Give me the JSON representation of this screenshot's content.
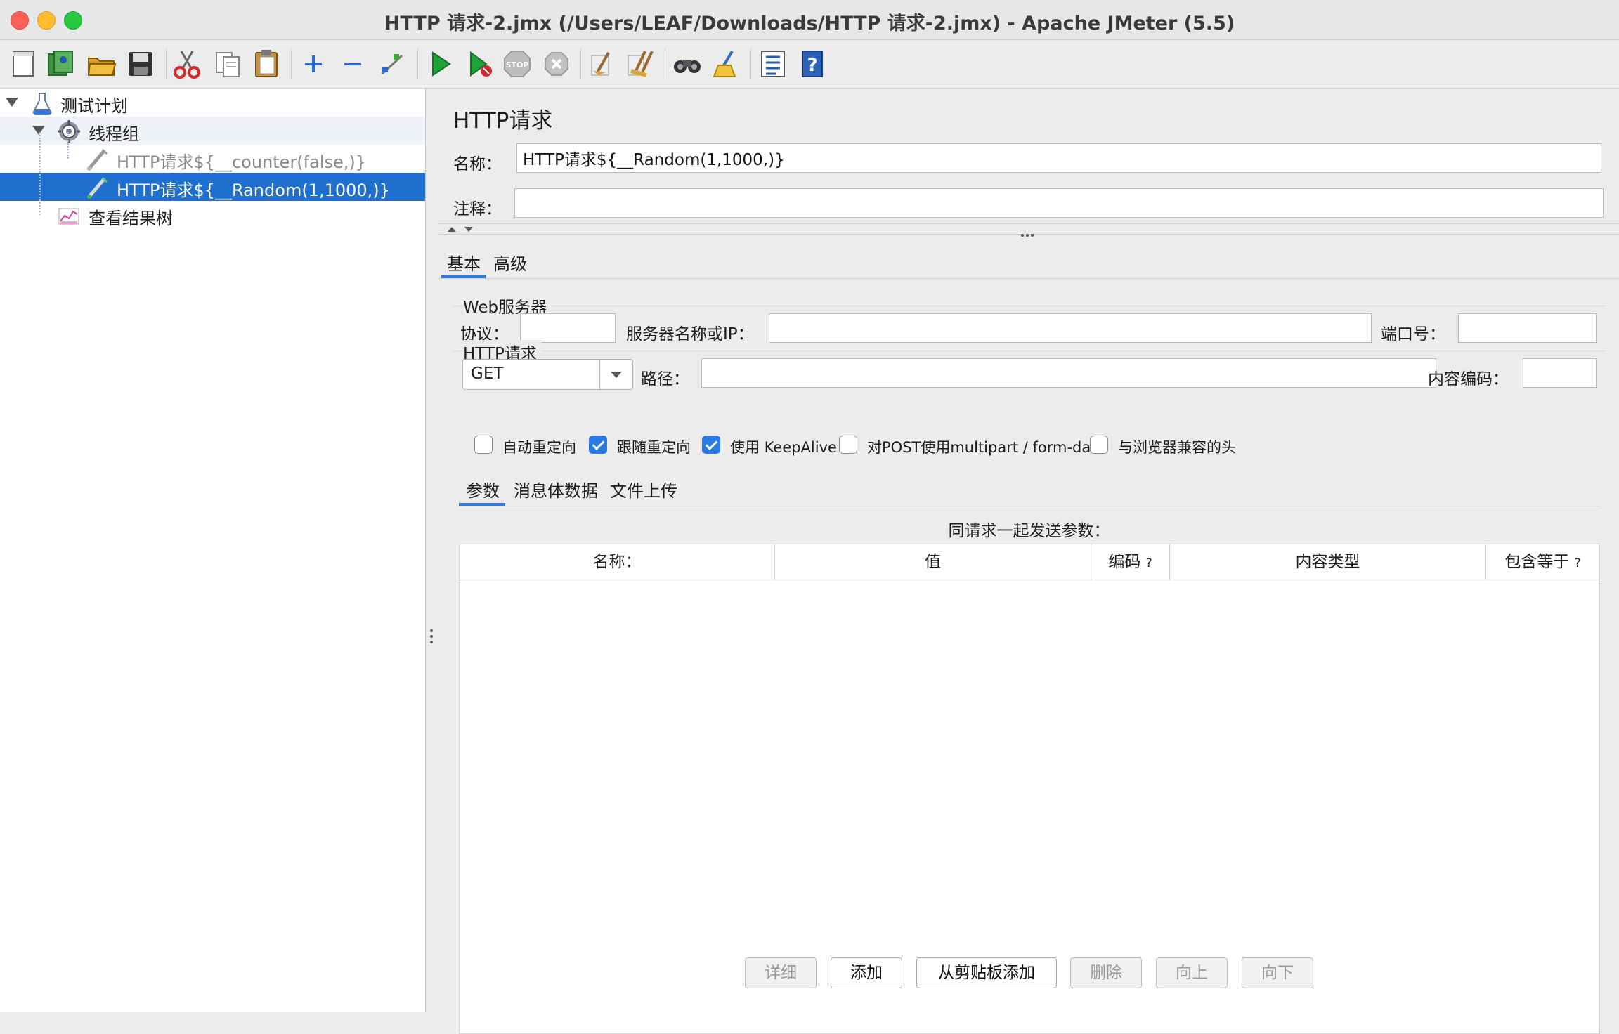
{
  "window": {
    "title": "HTTP 请求-2.jmx (/Users/LEAF/Downloads/HTTP 请求-2.jmx) - Apache JMeter (5.5)"
  },
  "toolbar": {
    "buttons": [
      {
        "name": "new-icon"
      },
      {
        "name": "templates-icon"
      },
      {
        "name": "open-icon"
      },
      {
        "name": "save-icon"
      },
      {
        "name": "cut-icon"
      },
      {
        "name": "copy-icon"
      },
      {
        "name": "paste-icon"
      },
      {
        "name": "expand-icon"
      },
      {
        "name": "collapse-icon"
      },
      {
        "name": "toggle-icon"
      },
      {
        "name": "start-icon"
      },
      {
        "name": "start-no-pause-icon"
      },
      {
        "name": "stop-icon"
      },
      {
        "name": "shutdown-icon"
      },
      {
        "name": "clear-icon"
      },
      {
        "name": "clear-all-icon"
      },
      {
        "name": "search-icon"
      },
      {
        "name": "reset-search-icon"
      },
      {
        "name": "function-helper-icon"
      },
      {
        "name": "help-icon"
      }
    ]
  },
  "tree": {
    "items": [
      {
        "label": "测试计划",
        "icon": "test-plan-icon",
        "state": "normal"
      },
      {
        "label": "线程组",
        "icon": "thread-group-icon",
        "state": "highlight"
      },
      {
        "label": "HTTP请求${__counter(false,)}",
        "icon": "sampler-icon",
        "state": "disabled"
      },
      {
        "label": "HTTP请求${__Random(1,1000,)}",
        "icon": "sampler-icon",
        "state": "selected"
      },
      {
        "label": "查看结果树",
        "icon": "listener-icon",
        "state": "normal"
      }
    ]
  },
  "panel": {
    "title": "HTTP请求",
    "name_label": "名称：",
    "name_value": "HTTP请求${__Random(1,1000,)}",
    "comment_label": "注释：",
    "comment_value": "",
    "tabs": [
      "基本",
      "高级"
    ],
    "active_tab": "基本",
    "web_server": {
      "group_label": "Web服务器",
      "protocol_label": "协议：",
      "protocol_value": "",
      "server_label": "服务器名称或IP：",
      "server_value": "",
      "port_label": "端口号：",
      "port_value": ""
    },
    "http_request": {
      "group_label": "HTTP请求",
      "method": "GET",
      "path_label": "路径：",
      "path_value": "",
      "encoding_label": "内容编码：",
      "encoding_value": ""
    },
    "options": [
      {
        "label": "自动重定向",
        "checked": false
      },
      {
        "label": "跟随重定向",
        "checked": true
      },
      {
        "label": "使用 KeepAlive",
        "checked": true
      },
      {
        "label": "对POST使用multipart / form-data",
        "checked": false
      },
      {
        "label": "与浏览器兼容的头",
        "checked": false
      }
    ],
    "sub_tabs": [
      "参数",
      "消息体数据",
      "文件上传"
    ],
    "active_sub_tab": "参数",
    "params_title": "同请求一起发送参数：",
    "columns": [
      "名称：",
      "值",
      "编码",
      "内容类型",
      "包含等于"
    ],
    "column_help": "?",
    "rows": [],
    "buttons": [
      {
        "label": "详细",
        "enabled": false
      },
      {
        "label": "添加",
        "enabled": true
      },
      {
        "label": "从剪贴板添加",
        "enabled": true
      },
      {
        "label": "删除",
        "enabled": false
      },
      {
        "label": "向上",
        "enabled": false
      },
      {
        "label": "向下",
        "enabled": false
      }
    ]
  }
}
